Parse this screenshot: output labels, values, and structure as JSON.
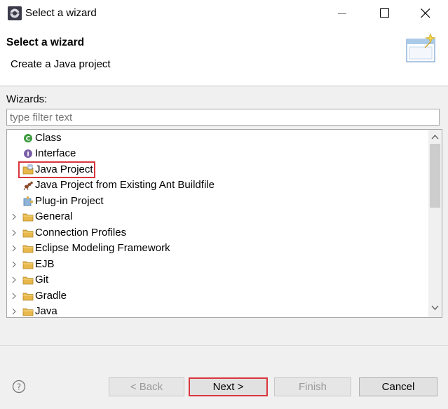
{
  "window": {
    "title": "Select a wizard"
  },
  "banner": {
    "title": "Select a wizard",
    "description": "Create a Java project"
  },
  "wizards": {
    "label": "Wizards:",
    "filter_placeholder": "type filter text",
    "items": [
      {
        "label": "Class",
        "icon": "class-icon"
      },
      {
        "label": "Interface",
        "icon": "interface-icon"
      },
      {
        "label": "Java Project",
        "icon": "java-project-icon"
      },
      {
        "label": "Java Project from Existing Ant Buildfile",
        "icon": "ant-icon"
      },
      {
        "label": "Plug-in Project",
        "icon": "plugin-icon"
      },
      {
        "label": "General",
        "icon": "folder-icon"
      },
      {
        "label": "Connection Profiles",
        "icon": "folder-icon"
      },
      {
        "label": "Eclipse Modeling Framework",
        "icon": "folder-icon"
      },
      {
        "label": "EJB",
        "icon": "folder-icon"
      },
      {
        "label": "Git",
        "icon": "folder-icon"
      },
      {
        "label": "Gradle",
        "icon": "folder-icon"
      },
      {
        "label": "Java",
        "icon": "folder-icon"
      }
    ]
  },
  "buttons": {
    "back": "< Back",
    "next": "Next >",
    "finish": "Finish",
    "cancel": "Cancel"
  },
  "colors": {
    "highlight": "#d9363e",
    "folder": "#e8b84a"
  }
}
